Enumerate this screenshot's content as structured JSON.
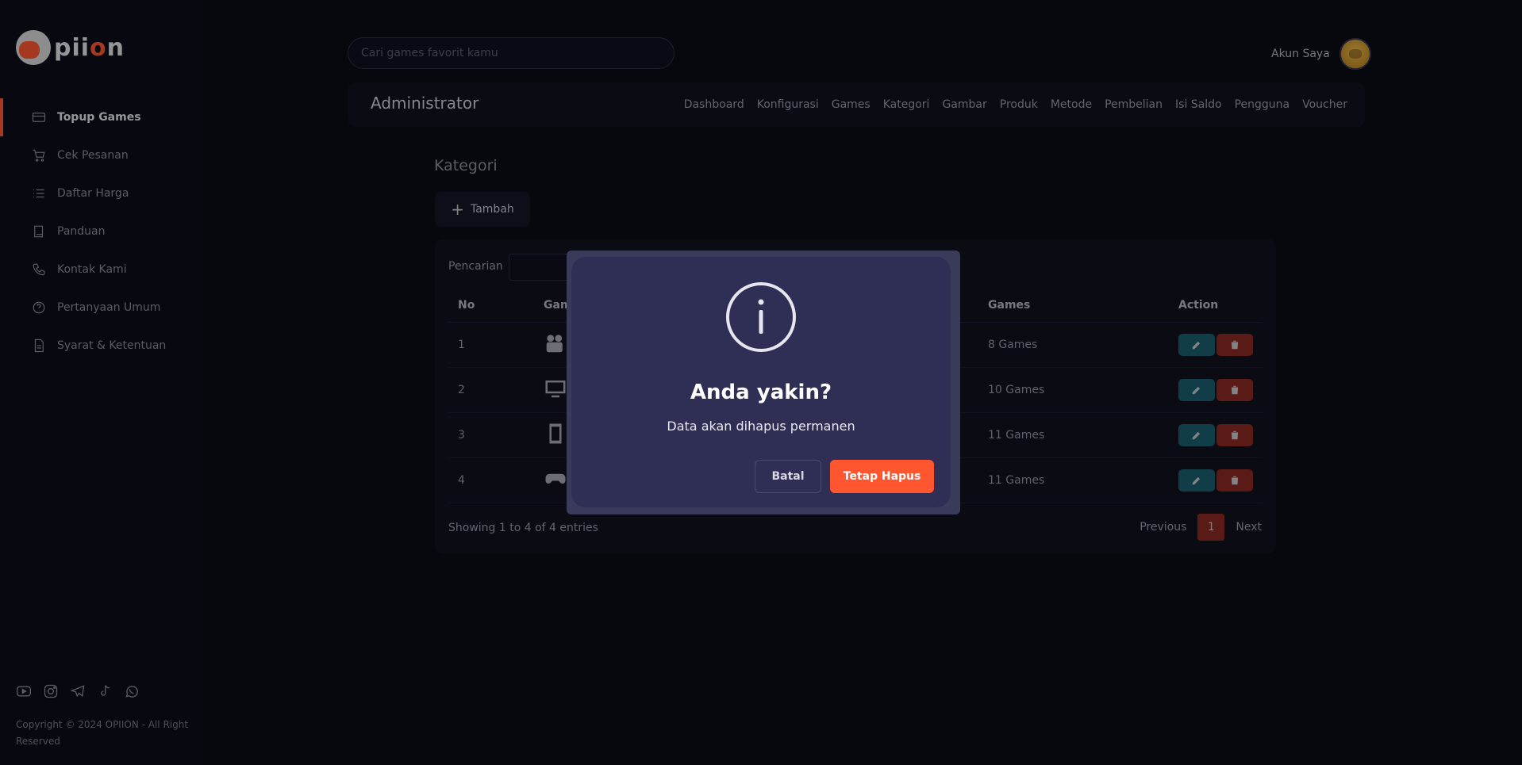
{
  "brand": {
    "logo_text_prefix": "pii",
    "logo_text_accent": "o",
    "logo_text_suffix": "n",
    "accent_color": "#ff5630"
  },
  "sidebar": {
    "items": [
      {
        "label": "Topup Games",
        "icon": "credit-card-icon",
        "active": true
      },
      {
        "label": "Cek Pesanan",
        "icon": "cart-icon",
        "active": false
      },
      {
        "label": "Daftar Harga",
        "icon": "list-icon",
        "active": false
      },
      {
        "label": "Panduan",
        "icon": "book-icon",
        "active": false
      },
      {
        "label": "Kontak Kami",
        "icon": "phone-icon",
        "active": false
      },
      {
        "label": "Pertanyaan Umum",
        "icon": "question-icon",
        "active": false
      },
      {
        "label": "Syarat & Ketentuan",
        "icon": "document-icon",
        "active": false
      }
    ],
    "socials": [
      "youtube-icon",
      "instagram-icon",
      "telegram-icon",
      "tiktok-icon",
      "whatsapp-icon"
    ],
    "copyright": "Copyright © 2024 OPIION - All Right Reserved"
  },
  "search": {
    "placeholder": "Cari games favorit kamu"
  },
  "account": {
    "label": "Akun Saya"
  },
  "admin": {
    "title": "Administrator",
    "nav": [
      "Dashboard",
      "Konfigurasi",
      "Games",
      "Kategori",
      "Gambar",
      "Produk",
      "Metode",
      "Pembelian",
      "Isi Saldo",
      "Pengguna",
      "Voucher"
    ]
  },
  "main": {
    "title": "Kategori",
    "add_label": "Tambah",
    "search_label": "Pencarian",
    "table": {
      "headers": [
        "No",
        "Gam",
        "Games",
        "Action"
      ],
      "rows": [
        {
          "no": "1",
          "icon": "video-camera-icon",
          "games": "8 Games"
        },
        {
          "no": "2",
          "icon": "monitor-icon",
          "games": "10 Games"
        },
        {
          "no": "3",
          "icon": "mobile-icon",
          "games": "11 Games"
        },
        {
          "no": "4",
          "icon": "gamepad-icon",
          "games": "11 Games"
        }
      ]
    },
    "showing": "Showing 1 to 4 of 4 entries",
    "pagination": {
      "previous": "Previous",
      "current": "1",
      "next": "Next"
    }
  },
  "modal": {
    "title": "Anda yakin?",
    "text": "Data akan dihapus permanen",
    "cancel_label": "Batal",
    "confirm_label": "Tetap Hapus"
  }
}
